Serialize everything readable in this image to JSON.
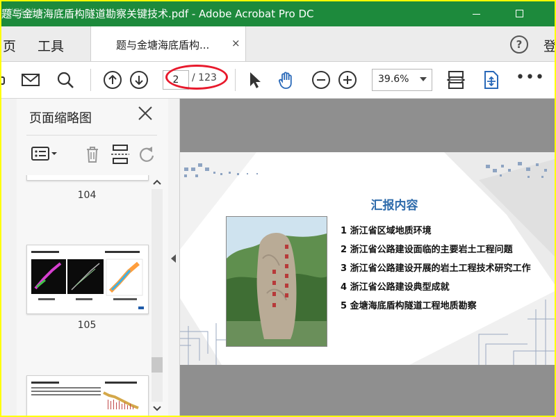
{
  "window": {
    "title": "题与金塘海底盾构隧道勘察关键技术.pdf - Adobe Acrobat Pro DC",
    "watermark": "学路游"
  },
  "tabs": {
    "home_label": "页",
    "tools_label": "工具",
    "doc_tab_label": "题与金塘海底盾构...",
    "close_glyph": "×",
    "help_glyph": "?",
    "signin_label": "登"
  },
  "toolbar": {
    "page_current": "2",
    "page_total": "/ 123",
    "zoom_value": "39.6%",
    "more_glyph": "•••"
  },
  "thumbnails_panel": {
    "title": "页面缩略图",
    "pages": [
      {
        "number": "104"
      },
      {
        "number": "105"
      },
      {
        "number": ""
      }
    ]
  },
  "slide": {
    "title": "汇报内容",
    "agenda": [
      "1 浙江省区域地质环境",
      "2 浙江省公路建设面临的主要岩土工程问题",
      "3 浙江省公路建设开展的岩土工程技术研究工作",
      "4 浙江省公路建设典型成就",
      "5 金塘海底盾构隧道工程地质勘察"
    ]
  },
  "colors": {
    "titlebar": "#1d8a3c",
    "annotation_red": "#e8192c",
    "slide_title_blue": "#2e6bab",
    "border_yellow": "#ffff00"
  }
}
